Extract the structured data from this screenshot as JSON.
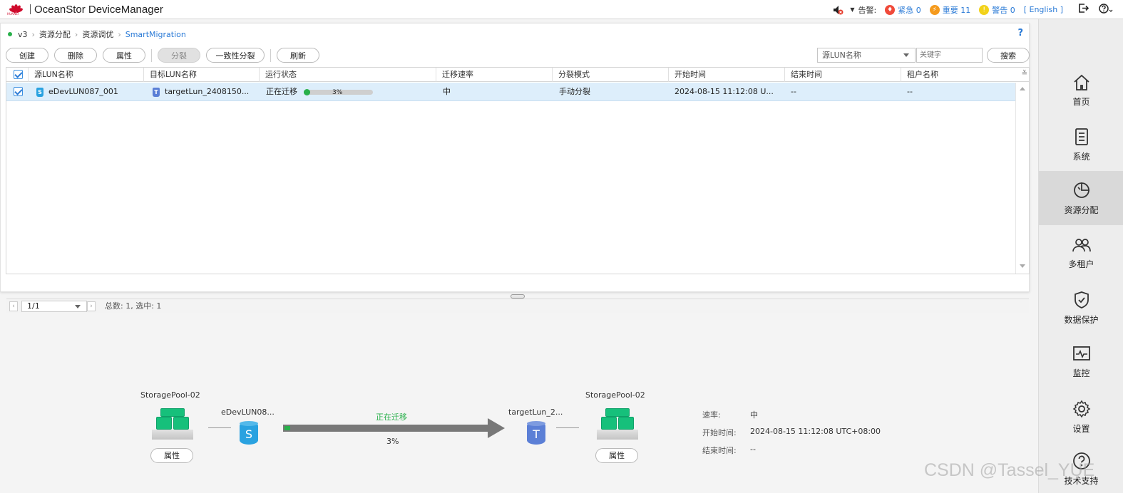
{
  "header": {
    "brand_word": "HUAWEI",
    "app_title": "OceanStor DeviceManager",
    "alarm_label": "告警:",
    "alarms": [
      {
        "label": "紧急 0",
        "color": "#f04a3a",
        "icon": "flame-icon"
      },
      {
        "label": "重要 11",
        "color": "#f59a1c",
        "icon": "bolt-icon"
      },
      {
        "label": "警告 0",
        "color": "#f2d21a",
        "icon": "exclamation-icon"
      }
    ],
    "language": "[ English ]"
  },
  "breadcrumb": {
    "items": [
      "v3",
      "资源分配",
      "资源调优",
      "SmartMigration"
    ],
    "help": "?"
  },
  "toolbar": {
    "create": "创建",
    "delete": "删除",
    "properties": "属性",
    "split": "分裂",
    "consistent_split": "一致性分裂",
    "refresh": "刷新"
  },
  "search": {
    "field_selected": "源LUN名称",
    "placeholder": "关键字",
    "button": "搜索"
  },
  "table": {
    "columns": [
      "源LUN名称",
      "目标LUN名称",
      "运行状态",
      "迁移速率",
      "分裂模式",
      "开始时间",
      "结束时间",
      "租户名称"
    ],
    "rows": [
      {
        "checked": true,
        "source": "eDevLUN087_001",
        "target": "targetLun_2408150...",
        "status": "正在迁移",
        "progress_percent": 3,
        "progress_label": "3%",
        "rate": "中",
        "split_mode": "手动分裂",
        "start_time": "2024-08-15 11:12:08 U...",
        "end_time": "--",
        "tenant": "--"
      }
    ]
  },
  "pager": {
    "page": "1/1",
    "summary": "总数: 1, 选中: 1"
  },
  "diagram": {
    "source_pool": "StoragePool-02",
    "target_pool": "StoragePool-02",
    "source_lun": "eDevLUN08...",
    "target_lun": "targetLun_2...",
    "status": "正在迁移",
    "progress_label": "3%",
    "progress_percent": 3,
    "pool_button": "属性",
    "details": [
      {
        "label": "速率:",
        "value": "中"
      },
      {
        "label": "开始时间:",
        "value": "2024-08-15 11:12:08 UTC+08:00"
      },
      {
        "label": "结束时间:",
        "value": "--"
      }
    ]
  },
  "nav": {
    "items": [
      {
        "label": "首页",
        "icon": "home-icon"
      },
      {
        "label": "系统",
        "icon": "system-icon"
      },
      {
        "label": "资源分配",
        "icon": "resource-icon",
        "active": true
      },
      {
        "label": "多租户",
        "icon": "tenant-icon"
      },
      {
        "label": "数据保护",
        "icon": "shield-icon"
      },
      {
        "label": "监控",
        "icon": "monitor-icon"
      },
      {
        "label": "设置",
        "icon": "gear-icon"
      },
      {
        "label": "技术支持",
        "icon": "help-icon"
      }
    ]
  },
  "watermark": "CSDN @Tassel_YUE"
}
